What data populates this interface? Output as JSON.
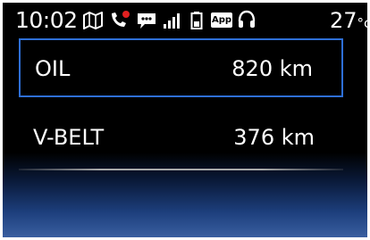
{
  "status_bar": {
    "time": "10:02",
    "temperature": "27",
    "temperature_unit": "°c",
    "icons": [
      "map-icon",
      "phone-missed-icon",
      "message-icon",
      "signal-icon",
      "battery-icon",
      "app-icon",
      "headset-icon"
    ],
    "app_badge_label": "App"
  },
  "maintenance": {
    "items": [
      {
        "label": "OIL",
        "value": "820 km",
        "selected": true
      },
      {
        "label": "V-BELT",
        "value": "376 km",
        "selected": false
      }
    ]
  },
  "colors": {
    "selection_border": "#2e6fd6",
    "background_top": "#000000",
    "background_bottom": "#3a5fa0",
    "missed_call_dot": "#e02020"
  }
}
